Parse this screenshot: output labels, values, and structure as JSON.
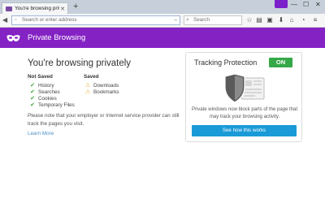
{
  "tab": {
    "title": "You're browsing privately",
    "close_icon": "close-icon"
  },
  "newtab_icon": "plus-icon",
  "window_controls": [
    "minimize-icon",
    "maximize-icon",
    "close-icon"
  ],
  "navbar": {
    "url_placeholder": "Search or enter address",
    "search_placeholder": "Search",
    "toolbar_icons": [
      "star-icon",
      "reading-list-icon",
      "lock-icon",
      "download-icon",
      "home-icon",
      "chat-icon",
      "menu-icon"
    ]
  },
  "header": {
    "title": "Private Browsing"
  },
  "main": {
    "title": "You're browsing privately",
    "not_saved": {
      "heading": "Not Saved",
      "items": [
        "History",
        "Searches",
        "Cookies",
        "Temporary Files"
      ]
    },
    "saved": {
      "heading": "Saved",
      "items": [
        "Downloads",
        "Bookmarks"
      ]
    },
    "note": "Please note that your employer or Internet service provider can still track the pages you visit.",
    "learn_more": "Learn More"
  },
  "tracking_card": {
    "title": "Tracking Protection",
    "status": "ON",
    "description": "Private windows now block parts of the page that may track your browsing activity.",
    "button": "See how this works"
  },
  "colors": {
    "header": "#8422c4",
    "on_badge": "#35a848",
    "button": "#1a9ad7",
    "link": "#4a90c8"
  }
}
